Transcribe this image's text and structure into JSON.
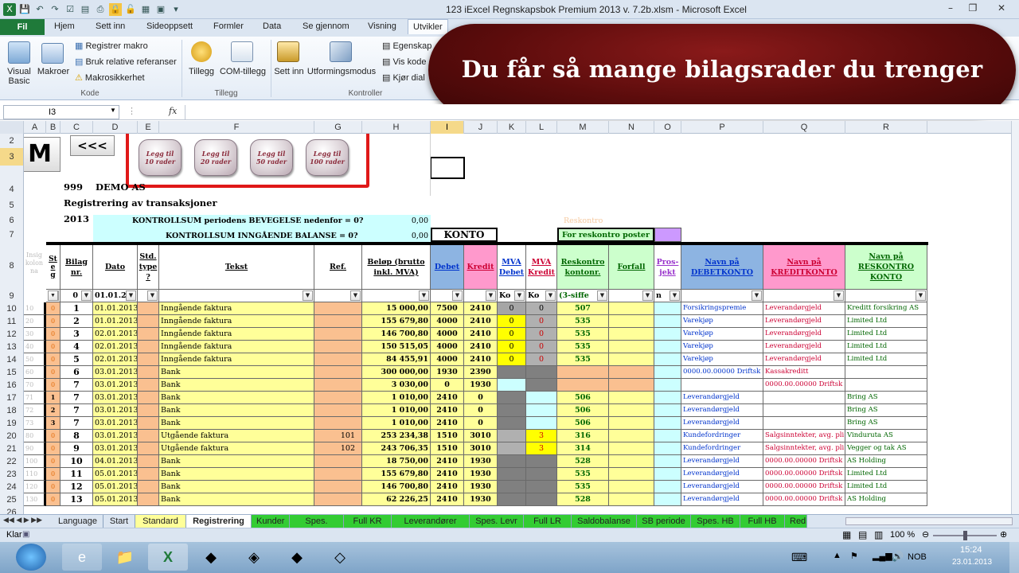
{
  "window": {
    "title": "123 iExcel Regnskapsbok Premium 2013 v. 7.2b.xlsm  -  Microsoft Excel"
  },
  "ribbon_tabs": [
    "Fil",
    "Hjem",
    "Sett inn",
    "Sideoppsett",
    "Formler",
    "Data",
    "Se gjennom",
    "Visning",
    "Utvikler"
  ],
  "ribbon": {
    "visual_basic": "Visual Basic",
    "macros": "Makroer",
    "record_macro": "Registrer makro",
    "relative_refs": "Bruk relative referanser",
    "macro_security": "Makrosikkerhet",
    "group_code": "Kode",
    "addins": "Tillegg",
    "com_addins": "COM-tillegg",
    "group_addins": "Tillegg",
    "insert": "Sett inn",
    "design_mode": "Utformingsmodus",
    "properties": "Egenskap",
    "view_code": "Vis kode",
    "run_dialog": "Kjør dial",
    "group_controls": "Kontroller"
  },
  "banner": "Du får så mange bilagsrader du trenger",
  "formula_bar": {
    "name_box": "I3",
    "fx": "fx"
  },
  "columns": [
    "A",
    "B",
    "C",
    "D",
    "E",
    "F",
    "G",
    "H",
    "I",
    "J",
    "K",
    "L",
    "M",
    "N",
    "O",
    "P",
    "Q",
    "R"
  ],
  "row_numbers": [
    "2",
    "3",
    "4",
    "5",
    "6",
    "7",
    "8",
    "9",
    "10",
    "11",
    "12",
    "13",
    "14",
    "15",
    "16",
    "17",
    "18",
    "19",
    "20",
    "21",
    "22",
    "23",
    "24",
    "25",
    "26"
  ],
  "sheet": {
    "m_button": "M",
    "back_button": "<<<",
    "add_buttons": [
      "Legg til 10 rader",
      "Legg til 20 rader",
      "Legg til 50 rader",
      "Legg til 100 rader"
    ],
    "company_no": "999",
    "company_name": "DEMO AS",
    "subtitle": "Registrering av transaksjoner",
    "year": "2013",
    "check1_label": "KONTROLLSUM periodens BEVEGELSE nedenfor = 0?",
    "check1_value": "0,00",
    "check2_label": "KONTROLLSUM INNGÅENDE BALANSE = 0?",
    "check2_value": "0,00",
    "konto_label": "KONTO",
    "reskontro_label": "For reskontro poster",
    "reskontro_faded": "Reskontro",
    "hidden_col_label": "Insig kolon na",
    "headers": {
      "steg": "Steg",
      "bilag": "Bilag nr.",
      "dato": "Dato",
      "std": "Std. type ?",
      "tekst": "Tekst",
      "ref": "Ref.",
      "belop": "Beløp (brutto inkl. MVA)",
      "debet": "Debet",
      "kredit": "Kredit",
      "mva_debet": "MVA Debet",
      "mva_kredit": "MVA Kredit",
      "reskontro": "Reskontro kontonr.",
      "forfall": "Forfall",
      "prosjekt": "Pros-jekt",
      "navn_debet": "Navn på DEBETKONTO",
      "navn_kredit": "Navn på KREDITKONTO",
      "navn_resk": "Navn på RESKONTRO KONTO"
    },
    "filter_row": {
      "bilag": "0",
      "dato": "01.01.2",
      "mva_d": "Ko",
      "mva_k": "Ko",
      "resk": "(3-siffe",
      "pros": "n"
    },
    "rows": [
      {
        "a": "10",
        "s": "0",
        "b": "1",
        "d": "01.01.2013",
        "t": "Inngående faktura",
        "r": "",
        "amt": "15 000,00",
        "de": "7500",
        "kr": "2410",
        "md": "0",
        "mk": "0",
        "res": "507",
        "nd": "Forsikringspremie",
        "nk": "Leverandørgjeld",
        "nr": "Kreditt forsikring AS"
      },
      {
        "a": "20",
        "s": "0",
        "b": "2",
        "d": "01.01.2013",
        "t": "Inngående faktura",
        "r": "",
        "amt": "155 679,80",
        "de": "4000",
        "kr": "2410",
        "md": "0",
        "mk": "0",
        "res": "535",
        "nd": "Varekjøp",
        "nk": "Leverandørgjeld",
        "nr": "Limited Ltd"
      },
      {
        "a": "30",
        "s": "0",
        "b": "3",
        "d": "02.01.2013",
        "t": "Inngående faktura",
        "r": "",
        "amt": "146 700,80",
        "de": "4000",
        "kr": "2410",
        "md": "0",
        "mk": "0",
        "res": "535",
        "nd": "Varekjøp",
        "nk": "Leverandørgjeld",
        "nr": "Limited Ltd"
      },
      {
        "a": "40",
        "s": "0",
        "b": "4",
        "d": "02.01.2013",
        "t": "Inngående faktura",
        "r": "",
        "amt": "150 515,05",
        "de": "4000",
        "kr": "2410",
        "md": "0",
        "mk": "0",
        "res": "535",
        "nd": "Varekjøp",
        "nk": "Leverandørgjeld",
        "nr": "Limited Ltd"
      },
      {
        "a": "50",
        "s": "0",
        "b": "5",
        "d": "02.01.2013",
        "t": "Inngående faktura",
        "r": "",
        "amt": "84 455,91",
        "de": "4000",
        "kr": "2410",
        "md": "0",
        "mk": "0",
        "res": "535",
        "nd": "Varekjøp",
        "nk": "Leverandørgjeld",
        "nr": "Limited Ltd"
      },
      {
        "a": "60",
        "s": "0",
        "b": "6",
        "d": "03.01.2013",
        "t": "Bank",
        "r": "",
        "amt": "300 000,00",
        "de": "1930",
        "kr": "2390",
        "md": "",
        "mk": "",
        "res": "",
        "nd": "0000.00.00000 Driftsk",
        "nk": "Kassakreditt",
        "nr": ""
      },
      {
        "a": "70",
        "s": "0",
        "b": "7",
        "d": "03.01.2013",
        "t": "Bank",
        "r": "",
        "amt": "3 030,00",
        "de": "0",
        "kr": "1930",
        "md": "",
        "mk": "",
        "res": "",
        "nd": "",
        "nk": "0000.00.00000 Driftsk",
        "nr": ""
      },
      {
        "a": "71",
        "s": "1",
        "b": "7",
        "d": "03.01.2013",
        "t": "Bank",
        "r": "",
        "amt": "1 010,00",
        "de": "2410",
        "kr": "0",
        "md": "",
        "mk": "",
        "res": "506",
        "nd": "Leverandørgjeld",
        "nk": "",
        "nr": "Bring AS"
      },
      {
        "a": "72",
        "s": "2",
        "b": "7",
        "d": "03.01.2013",
        "t": "Bank",
        "r": "",
        "amt": "1 010,00",
        "de": "2410",
        "kr": "0",
        "md": "",
        "mk": "",
        "res": "506",
        "nd": "Leverandørgjeld",
        "nk": "",
        "nr": "Bring AS"
      },
      {
        "a": "73",
        "s": "3",
        "b": "7",
        "d": "03.01.2013",
        "t": "Bank",
        "r": "",
        "amt": "1 010,00",
        "de": "2410",
        "kr": "0",
        "md": "",
        "mk": "",
        "res": "506",
        "nd": "Leverandørgjeld",
        "nk": "",
        "nr": "Bring AS"
      },
      {
        "a": "80",
        "s": "0",
        "b": "8",
        "d": "03.01.2013",
        "t": "Utgående faktura",
        "r": "101",
        "amt": "253 234,38",
        "de": "1510",
        "kr": "3010",
        "md": "",
        "mk": "3",
        "res": "316",
        "nd": "Kundefordringer",
        "nk": "Salgsinntekter, avg. pli",
        "nr": "Vinduruta AS"
      },
      {
        "a": "90",
        "s": "0",
        "b": "9",
        "d": "03.01.2013",
        "t": "Utgående faktura",
        "r": "102",
        "amt": "243 706,35",
        "de": "1510",
        "kr": "3010",
        "md": "",
        "mk": "3",
        "res": "314",
        "nd": "Kundefordringer",
        "nk": "Salgsinntekter, avg. pli",
        "nr": "Vegger og tak AS"
      },
      {
        "a": "100",
        "s": "0",
        "b": "10",
        "d": "04.01.2013",
        "t": "Bank",
        "r": "",
        "amt": "18 750,00",
        "de": "2410",
        "kr": "1930",
        "md": "",
        "mk": "",
        "res": "528",
        "nd": "Leverandørgjeld",
        "nk": "0000.00.00000 Driftsk",
        "nr": "AS Holding"
      },
      {
        "a": "110",
        "s": "0",
        "b": "11",
        "d": "05.01.2013",
        "t": "Bank",
        "r": "",
        "amt": "155 679,80",
        "de": "2410",
        "kr": "1930",
        "md": "",
        "mk": "",
        "res": "535",
        "nd": "Leverandørgjeld",
        "nk": "0000.00.00000 Driftsk",
        "nr": "Limited Ltd"
      },
      {
        "a": "120",
        "s": "0",
        "b": "12",
        "d": "05.01.2013",
        "t": "Bank",
        "r": "",
        "amt": "146 700,80",
        "de": "2410",
        "kr": "1930",
        "md": "",
        "mk": "",
        "res": "535",
        "nd": "Leverandørgjeld",
        "nk": "0000.00.00000 Driftsk",
        "nr": "Limited Ltd"
      },
      {
        "a": "130",
        "s": "0",
        "b": "13",
        "d": "05.01.2013",
        "t": "Bank",
        "r": "",
        "amt": "62 226,25",
        "de": "2410",
        "kr": "1930",
        "md": "",
        "mk": "",
        "res": "528",
        "nd": "Leverandørgjeld",
        "nk": "0000.00.00000 Driftsk",
        "nr": "AS Holding"
      }
    ]
  },
  "sheet_tabs": [
    "Language",
    "Start",
    "Standard",
    "Registrering",
    "Kunder",
    "Spes. Kund",
    "Full KR",
    "Leverandører",
    "Spes. Levr",
    "Full LR",
    "Saldobalanse",
    "SB periode",
    "Spes. HB",
    "Full HB",
    "Red"
  ],
  "status": {
    "ready": "Klar",
    "zoom": "100 %"
  },
  "taskbar": {
    "lang": "NOB",
    "time": "15:24",
    "date": "23.01.2013"
  },
  "colors": {
    "green_tab": "#1f7a3a",
    "banner": "#6a1010",
    "yellow": "#ffff99",
    "salmon": "#fac090",
    "cyan": "#ccffff",
    "red_frame": "#e01818"
  }
}
